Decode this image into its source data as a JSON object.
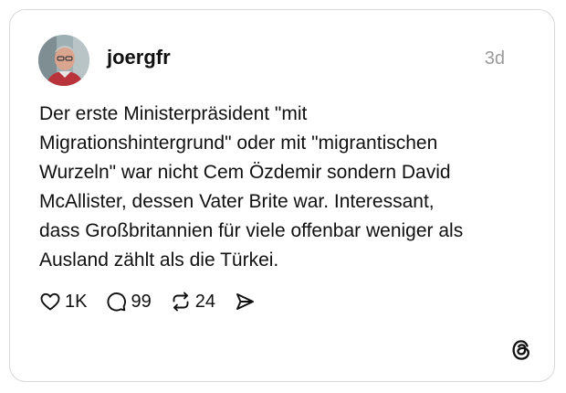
{
  "post": {
    "username": "joergfr",
    "timestamp": "3d",
    "text_lines": [
      "Der erste Ministerpräsident \"mit",
      "Migrationshintergrund\" oder mit \"migrantischen",
      "Wurzeln\" war nicht Cem Özdemir sondern David",
      "McAllister, dessen Vater Brite war. Interessant,",
      "dass Großbritannien für viele offenbar weniger als",
      "Ausland zählt als die Türkei."
    ]
  },
  "actions": {
    "like_count": "1K",
    "reply_count": "99",
    "repost_count": "24"
  },
  "icons": {
    "like": "heart-icon",
    "reply": "comment-icon",
    "repost": "repost-icon",
    "share": "send-icon",
    "brand": "threads-logo-icon"
  }
}
